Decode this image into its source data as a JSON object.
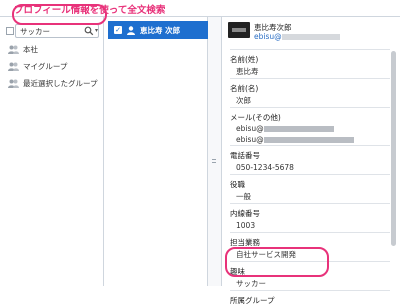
{
  "annotation": {
    "text": "プロフィール情報を使って全文検索",
    "color": "#e8327a"
  },
  "colors": {
    "accent": "#1e6fcf",
    "link": "#2a6ec4",
    "highlight": "#e8327a"
  },
  "search": {
    "value": "サッカー",
    "icon": "search-icon",
    "caret_icon": "caret-down-icon"
  },
  "nav": {
    "items": [
      {
        "label": "本社",
        "icon": "group-icon"
      },
      {
        "label": "マイグループ",
        "icon": "group-icon"
      },
      {
        "label": "最近選択したグループ",
        "icon": "group-icon"
      }
    ]
  },
  "results": {
    "items": [
      {
        "name": "恵比寿 次郎",
        "checked": true,
        "icon": "user-icon"
      }
    ]
  },
  "profile": {
    "display_name": "恵比寿次郎",
    "email_prefix": "ebisu@",
    "fields": [
      {
        "label": "名前(姓)",
        "value": "恵比寿"
      },
      {
        "label": "名前(名)",
        "value": "次郎"
      },
      {
        "label": "メール(その他)",
        "values": [
          "ebisu@",
          "ebisu@"
        ]
      },
      {
        "label": "電話番号",
        "value": "050-1234-5678"
      },
      {
        "label": "役職",
        "value": "一般"
      },
      {
        "label": "内線番号",
        "value": "1003"
      },
      {
        "label": "担当業務",
        "value": "自社サービス開発"
      },
      {
        "label": "趣味",
        "value": "サッカー"
      },
      {
        "label": "所属グループ",
        "value": ""
      }
    ]
  }
}
